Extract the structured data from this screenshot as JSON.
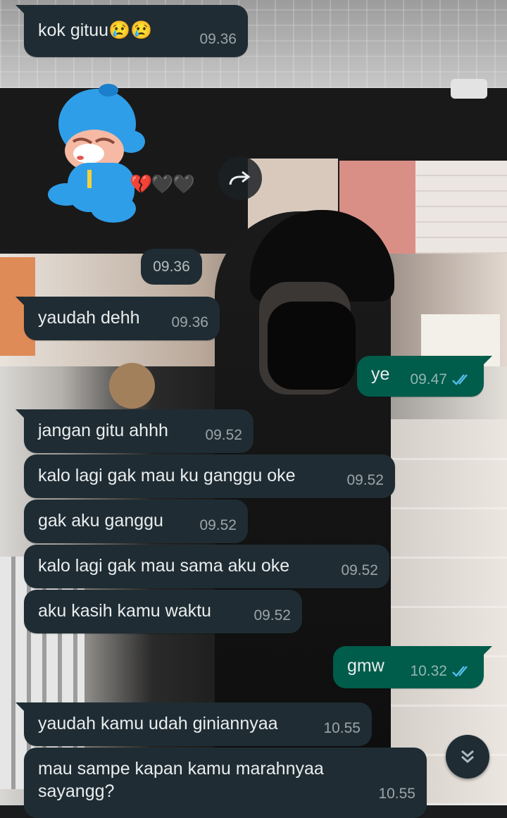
{
  "chat": {
    "messages": [
      {
        "direction": "in",
        "text": "kok gituu😢😢",
        "time": "09.36"
      },
      {
        "direction": "in",
        "type": "sticker",
        "sticker": "crying-pocoyo-sticker",
        "hearts": "💔🖤🖤",
        "time": "09.36"
      },
      {
        "direction": "in",
        "text": "yaudah dehh",
        "time": "09.36"
      },
      {
        "direction": "out",
        "text": "ye",
        "time": "09.47",
        "status": "read"
      },
      {
        "direction": "in",
        "text": "jangan gitu ahhh",
        "time": "09.52"
      },
      {
        "direction": "in",
        "text": "kalo lagi gak mau ku ganggu oke",
        "time": "09.52"
      },
      {
        "direction": "in",
        "text": "gak aku ganggu",
        "time": "09.52"
      },
      {
        "direction": "in",
        "text": "kalo lagi gak mau sama aku oke",
        "time": "09.52"
      },
      {
        "direction": "in",
        "text": "aku kasih kamu waktu",
        "time": "09.52"
      },
      {
        "direction": "out",
        "text": "gmw",
        "time": "10.32",
        "status": "read"
      },
      {
        "direction": "in",
        "text": "yaudah kamu udah giniannyaa",
        "time": "10.55"
      },
      {
        "direction": "in",
        "text": "mau sampe kapan kamu marahnyaa sayangg?",
        "time": "10.55"
      }
    ]
  },
  "icons": {
    "forward": "forward-icon",
    "scroll_down": "double-chevron-down-icon",
    "read_receipt": "double-check-icon"
  },
  "colors": {
    "incoming_bubble": "#1f2c33",
    "outgoing_bubble": "#005c4b",
    "read_tick": "#53bdeb",
    "text": "#e9edef"
  }
}
